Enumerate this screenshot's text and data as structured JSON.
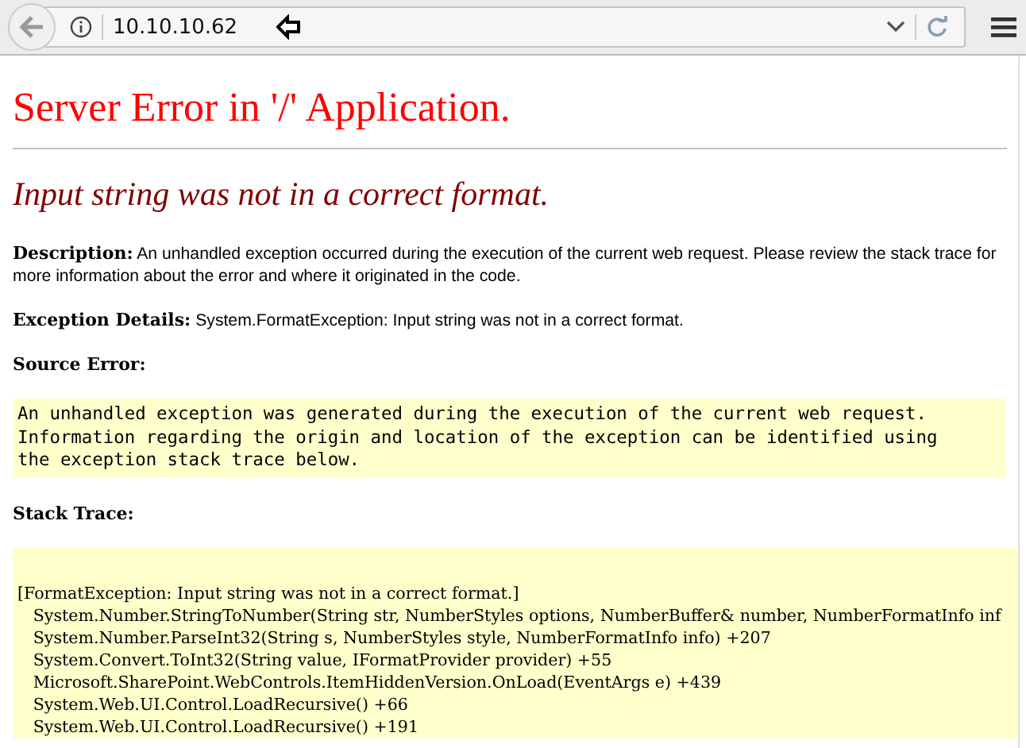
{
  "browser": {
    "address": "10.10.10.62"
  },
  "page": {
    "title": "Server Error in '/' Application.",
    "subtitle": "Input string was not in a correct format.",
    "description": {
      "text": "**Description:** An unhandled exception occurred during the execution of the current web request. Please review the stack trace for more information about the error and where it originated in the code."
    },
    "exception_details": {
      "label": "Exception Details:",
      "text": "System.FormatException: Input string was not in a correct format."
    },
    "source_error": {
      "label": "Source Error:",
      "lines": [
        "An unhandled exception was generated during the execution of the current web request.",
        "Information regarding the origin and location of the exception can be identified using",
        "the exception stack trace below."
      ]
    },
    "stack_trace": {
      "label": "Stack Trace:",
      "lines": [
        "[FormatException: Input string was not in a correct format.]",
        "   System.Number.StringToNumber(String str, NumberStyles options, NumberBuffer& number, NumberFormatInfo inf",
        "   System.Number.ParseInt32(String s, NumberStyles style, NumberFormatInfo info) +207",
        "   System.Convert.ToInt32(String value, IFormatProvider provider) +55",
        "   Microsoft.SharePoint.WebControls.ItemHiddenVersion.OnLoad(EventArgs e) +439",
        "   System.Web.UI.Control.LoadRecursive() +66",
        "   System.Web.UI.Control.LoadRecursive() +191"
      ]
    }
  }
}
